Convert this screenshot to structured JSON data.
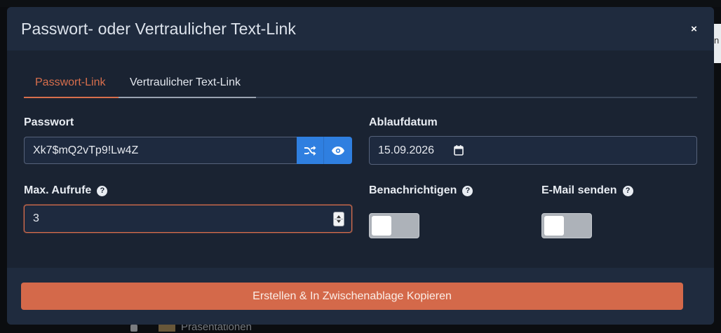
{
  "background": {
    "right_edge_text": "n",
    "folder_name": "Präsentationen"
  },
  "modal": {
    "title": "Passwort- oder Vertraulicher Text-Link",
    "close_glyph": "×"
  },
  "tabs": [
    {
      "label": "Passwort-Link",
      "active": true
    },
    {
      "label": "Vertraulicher Text-Link",
      "active": false
    }
  ],
  "form": {
    "password": {
      "label": "Passwort",
      "value": "Xk7$mQ2vTp9!Lw4Z"
    },
    "expiry": {
      "label": "Ablaufdatum",
      "value": "15.09.2026"
    },
    "max_views": {
      "label": "Max. Aufrufe",
      "value": "3"
    },
    "notify": {
      "label": "Benachrichtigen",
      "enabled": false
    },
    "send_email": {
      "label": "E-Mail senden",
      "enabled": false
    }
  },
  "footer": {
    "submit_label": "Erstellen & In Zwischenablage Kopieren"
  },
  "colors": {
    "accent": "#d4694a",
    "primary_blue": "#2f7fe0",
    "modal_bg": "#1a2332",
    "header_bg": "#1f2b3e"
  },
  "icons": {
    "shuffle": "shuffle-icon",
    "eye": "eye-icon",
    "calendar": "calendar-icon",
    "help": "question-circle-icon",
    "close": "close-icon"
  }
}
